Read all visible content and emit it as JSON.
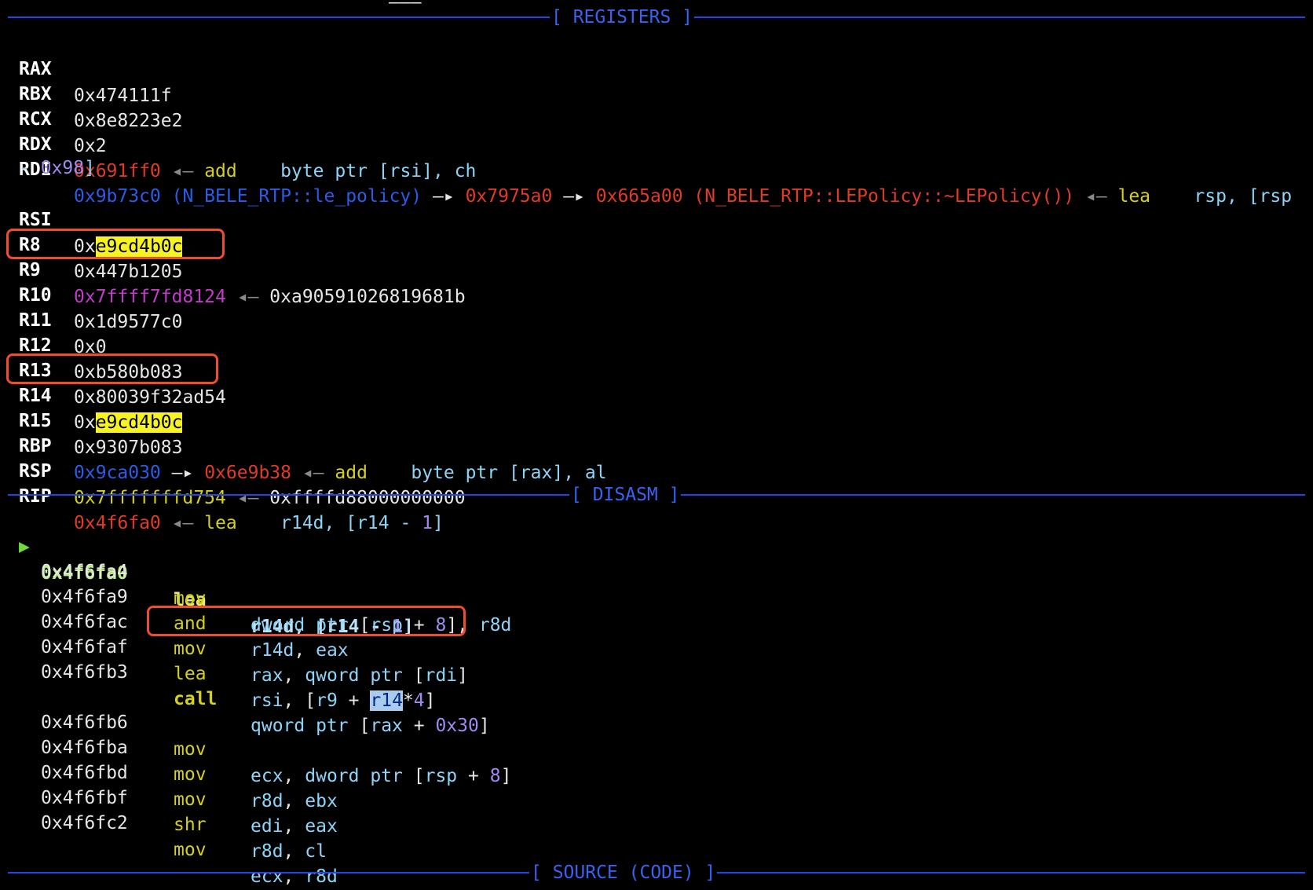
{
  "top_marker": "———",
  "sections": {
    "registers": "[ REGISTERS ]",
    "disasm": "[ DISASM ]",
    "source": "[ SOURCE (CODE) ]"
  },
  "arrows": {
    "deref": "—▸",
    "points_to": "◂—"
  },
  "registers": {
    "RAX": {
      "name": "RAX",
      "value": "0x474111f"
    },
    "RBX": {
      "name": "RBX",
      "value": "0x8e8223e2"
    },
    "RCX": {
      "name": "RCX",
      "value": "0x2"
    },
    "RDX": {
      "name": "RDX",
      "value": "0x691ff0",
      "mnemonic": "add",
      "operands": "byte ptr [rsi], ch"
    },
    "RDI": {
      "name": "RDI",
      "value": "0x9b73c0",
      "symbol": "(N_BELE_RTP::le_policy)",
      "ptr1": "0x7975a0",
      "ptr2": "0x665a00",
      "ptr2_symbol": "(N_BELE_RTP::LEPolicy::~LEPolicy())",
      "mnemonic": "lea",
      "operands_1": "rsp, [rsp",
      "operands_2_prefix": "-",
      "operands_2_num": "0x98",
      "operands_2_suffix": "]"
    },
    "RSI": {
      "name": "RSI",
      "prefix": "0x",
      "highlight": "e9cd4b0c"
    },
    "R8": {
      "name": "R8",
      "value": "0x447b1205"
    },
    "R9": {
      "name": "R9",
      "value": "0x7ffff7fd8124",
      "target": "0xa90591026819681b"
    },
    "R10": {
      "name": "R10",
      "value": "0x1d9577c0"
    },
    "R11": {
      "name": "R11",
      "value": "0x0"
    },
    "R12": {
      "name": "R12",
      "value": "0xb580b083"
    },
    "R13": {
      "name": "R13",
      "value": "0x80039f32ad54"
    },
    "R14": {
      "name": "R14",
      "prefix": "0x",
      "highlight": "e9cd4b0c"
    },
    "R15": {
      "name": "R15",
      "value": "0x9307b083"
    },
    "RBP": {
      "name": "RBP",
      "value": "0x9ca030",
      "ptr1": "0x6e9b38",
      "mnemonic": "add",
      "operands": "byte ptr [rax], al"
    },
    "RSP": {
      "name": "RSP",
      "value": "0x7fffffffd754",
      "target": "0xffffd88000000000"
    },
    "RIP": {
      "name": "RIP",
      "value": "0x4f6fa0",
      "mnemonic": "lea",
      "operands_pre": "r14d, [r14 - ",
      "operands_num": "1",
      "operands_post": "]"
    }
  },
  "disasm": {
    "current_marker": "▶",
    "rows": [
      {
        "addr": "0x4f6fa0",
        "mnemonic": "lea",
        "operands": "r14d, [r14 - 1]"
      },
      {
        "addr": "0x4f6fa4",
        "mnemonic": "mov",
        "operands": "dword ptr [rsp + 8], r8d"
      },
      {
        "addr": "0x4f6fa9",
        "mnemonic": "and",
        "operands": "r14d, eax"
      },
      {
        "addr": "0x4f6fac",
        "mnemonic": "mov",
        "operands": "rax, qword ptr [rdi]"
      },
      {
        "addr": "0x4f6faf",
        "mnemonic": "lea",
        "operands": "rsi, [r9 + r14*4]"
      },
      {
        "addr": "0x4f6fb3",
        "mnemonic": "call",
        "operands": "qword ptr [rax + 0x30]"
      },
      {
        "addr": "0x4f6fb6",
        "mnemonic": "mov",
        "operands": "ecx, dword ptr [rsp + 8]"
      },
      {
        "addr": "0x4f6fba",
        "mnemonic": "mov",
        "operands": "r8d, ebx"
      },
      {
        "addr": "0x4f6fbd",
        "mnemonic": "mov",
        "operands": "edi, eax"
      },
      {
        "addr": "0x4f6fbf",
        "mnemonic": "shr",
        "operands": "r8d, cl"
      },
      {
        "addr": "0x4f6fc2",
        "mnemonic": "mov",
        "operands": "ecx, r8d"
      }
    ]
  },
  "colors": {
    "section_rule": "#2244e8",
    "annotation_box": "#ee4e2c",
    "highlight": "#f7f320"
  }
}
